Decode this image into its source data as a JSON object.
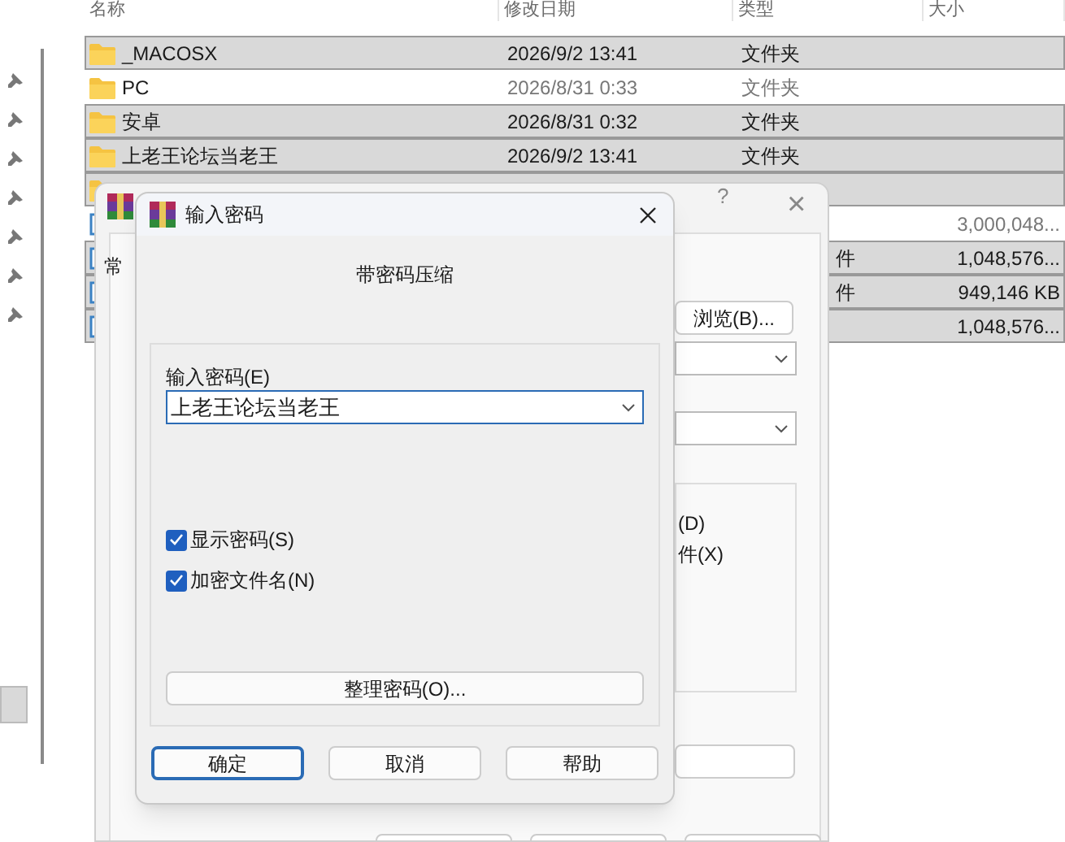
{
  "file_list": {
    "columns": [
      "名称",
      "修改日期",
      "类型",
      "大小"
    ],
    "rows": [
      {
        "kind": "folder",
        "name": "_MACOSX",
        "date": "2026/9/2 13:41",
        "type": "文件夹",
        "selected": true
      },
      {
        "kind": "folder",
        "name": "PC",
        "date": "2026/8/31 0:33",
        "type": "文件夹",
        "selected": false
      },
      {
        "kind": "folder",
        "name": "安卓",
        "date": "2026/8/31 0:32",
        "type": "文件夹",
        "selected": true
      },
      {
        "kind": "folder",
        "name": "上老王论坛当老王",
        "date": "2026/9/2 13:41",
        "type": "文件夹",
        "selected": true
      },
      {
        "kind": "folder",
        "selected": true
      },
      {
        "kind": "file",
        "size": "3,000,048...",
        "selected": false
      },
      {
        "kind": "file",
        "type": "件",
        "size": "1,048,576...",
        "selected": true
      },
      {
        "kind": "file",
        "type": "件",
        "size": "949,146 KB",
        "selected": true
      },
      {
        "kind": "file",
        "size": "1,048,576...",
        "selected": true
      }
    ]
  },
  "back_dialog": {
    "tab": "常",
    "help": "?",
    "close": "×",
    "browse_button": "浏览(B)...",
    "option_1": "(D)",
    "option_2": "件(X)"
  },
  "password_dialog": {
    "title": "输入密码",
    "heading": "带密码压缩",
    "field_label": "输入密码(E)",
    "password": "上老王论坛当老王",
    "checkboxes": [
      {
        "label": "显示密码(S)",
        "checked": true
      },
      {
        "label": "加密文件名(N)",
        "checked": true
      }
    ],
    "organize_button": "整理密码(O)...",
    "buttons": [
      {
        "label": "确定",
        "selected": true
      },
      {
        "label": "取消",
        "selected": false
      },
      {
        "label": "帮助",
        "selected": false
      }
    ]
  }
}
